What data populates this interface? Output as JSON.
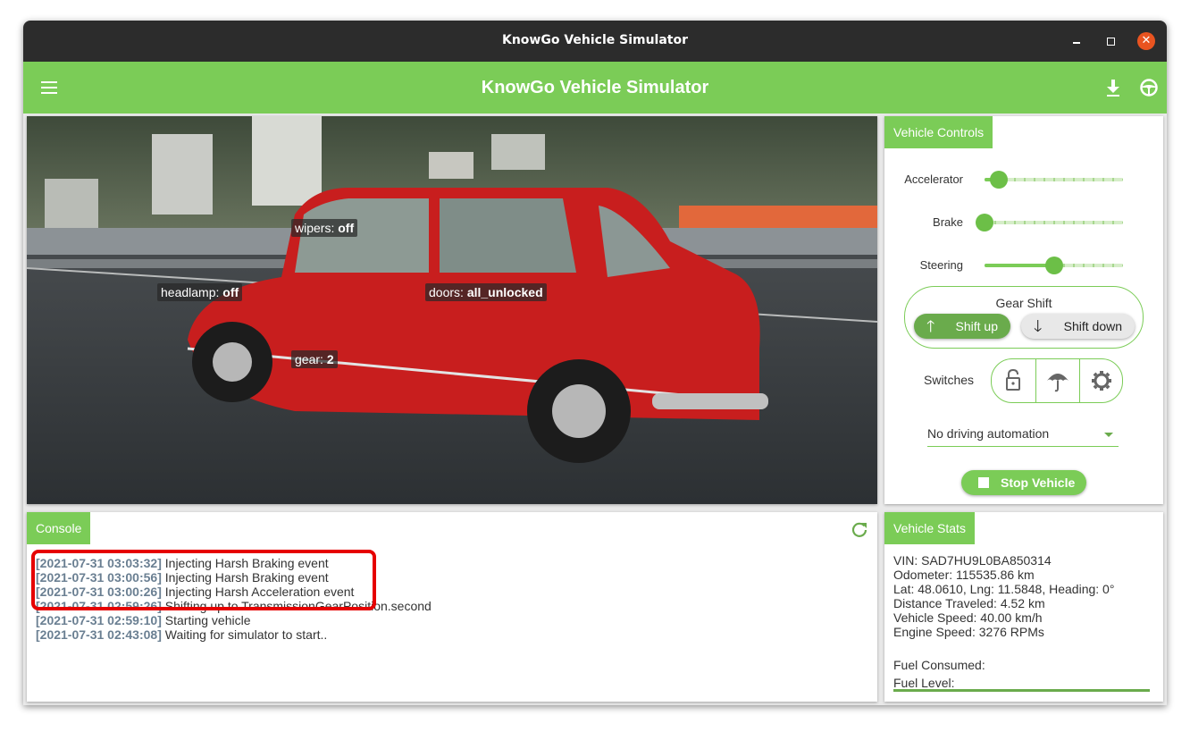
{
  "window": {
    "title": "KnowGo Vehicle Simulator"
  },
  "appbar": {
    "title": "KnowGo Vehicle Simulator"
  },
  "viewer": {
    "labels": {
      "wipers": {
        "key": "wipers:",
        "value": "off"
      },
      "headlamp": {
        "key": "headlamp:",
        "value": "off"
      },
      "doors": {
        "key": "doors:",
        "value": "all_unlocked"
      },
      "gear": {
        "key": "gear:",
        "value": "2"
      }
    }
  },
  "controls": {
    "tab": "Vehicle Controls",
    "accelerator": {
      "label": "Accelerator",
      "value": 0.1
    },
    "brake": {
      "label": "Brake",
      "value": 0.0
    },
    "steering": {
      "label": "Steering",
      "value": 0.5
    },
    "gear_shift": {
      "title": "Gear Shift",
      "up": "Shift up",
      "down": "Shift down"
    },
    "switches": {
      "label": "Switches",
      "icons": [
        "lock-icon",
        "umbrella-icon",
        "gear-icon"
      ]
    },
    "automation": {
      "selected": "No driving automation"
    },
    "stop_button": "Stop Vehicle"
  },
  "console": {
    "tab": "Console",
    "log": [
      {
        "ts": "[2021-07-31 03:03:32]",
        "msg": " Injecting Harsh Braking event"
      },
      {
        "ts": "[2021-07-31 03:00:56]",
        "msg": " Injecting Harsh Braking event"
      },
      {
        "ts": "[2021-07-31 03:00:26]",
        "msg": " Injecting Harsh Acceleration event"
      },
      {
        "ts": "[2021-07-31 02:59:26]",
        "msg": " Shifting up to TransmissionGearPosition.second"
      },
      {
        "ts": "[2021-07-31 02:59:10]",
        "msg": " Starting vehicle"
      },
      {
        "ts": "[2021-07-31 02:43:08]",
        "msg": " Waiting for simulator to start.."
      }
    ]
  },
  "stats": {
    "tab": "Vehicle Stats",
    "vin": "VIN: SAD7HU9L0BA850314",
    "odometer": "Odometer: 115535.86 km",
    "position": "Lat: 48.0610, Lng: 11.5848, Heading: 0°",
    "distance": "Distance Traveled: 4.52 km",
    "speed": "Vehicle Speed: 40.00 km/h",
    "engine": "Engine Speed: 3276 RPMs",
    "fuel_consumed": "Fuel Consumed:",
    "fuel_level": "Fuel Level:",
    "fuel_level_value": 1.0
  },
  "colors": {
    "accent": "#7bcc57",
    "highlight": "#e60000",
    "titlebar": "#2c2c2c"
  }
}
